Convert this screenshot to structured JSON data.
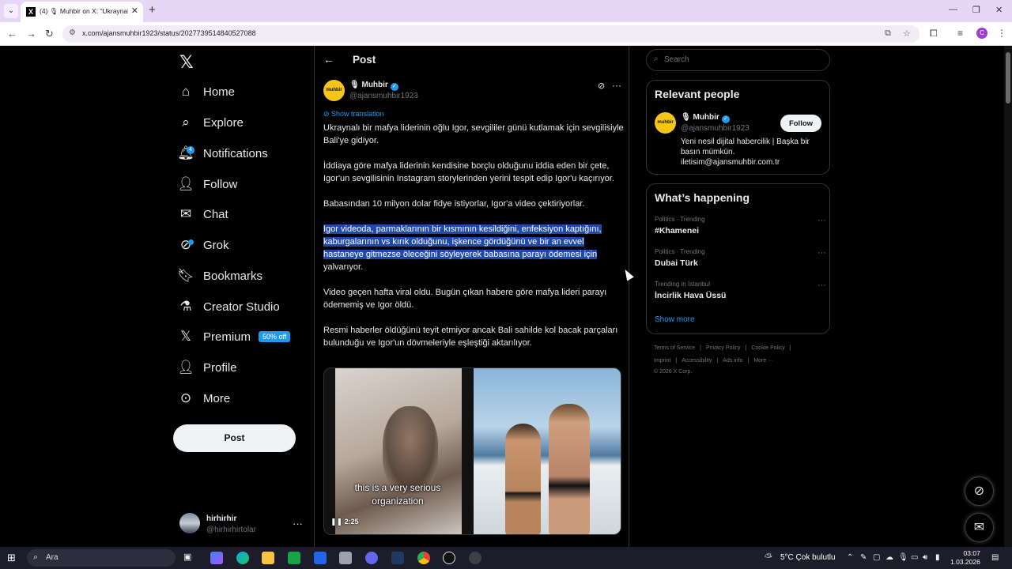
{
  "browser": {
    "tab_title": "(4) 🎙 Muhbir on X: \"Ukraynalı",
    "url": "x.com/ajansmuhbir1923/status/2027739514840527088"
  },
  "sidebar": {
    "items": [
      {
        "label": "Home",
        "icon": "home-icon"
      },
      {
        "label": "Explore",
        "icon": "search-icon"
      },
      {
        "label": "Notifications",
        "icon": "bell-icon",
        "badge": "4"
      },
      {
        "label": "Follow",
        "icon": "person-plus-icon"
      },
      {
        "label": "Chat",
        "icon": "mail-icon"
      },
      {
        "label": "Grok",
        "icon": "grok-icon"
      },
      {
        "label": "Bookmarks",
        "icon": "bookmark-icon"
      },
      {
        "label": "Creator Studio",
        "icon": "flask-icon"
      },
      {
        "label": "Premium",
        "icon": "x-icon",
        "badge": "50% off"
      },
      {
        "label": "Profile",
        "icon": "person-icon"
      },
      {
        "label": "More",
        "icon": "more-circle-icon"
      }
    ],
    "post_button": "Post",
    "account": {
      "name": "hirhirhir",
      "handle": "@hirhirhirtolar"
    }
  },
  "main": {
    "heading": "Post",
    "author": {
      "name": "Muhbir",
      "handle": "@ajansmuhbir1923",
      "avatar_text": "muhbir"
    },
    "show_translation": "Show translation",
    "paragraphs": [
      "Ukraynalı bir mafya liderinin oğlu Igor, sevgililer günü kutlamak için sevgilisiyle Bali'ye gidiyor.",
      "İddiaya göre mafya liderinin kendisine borçlu olduğunu iddia eden bir çete, Igor'un sevgilisinin Instagram storylerinden yerini tespit edip Igor'u kaçırıyor.",
      "Babasından 10 milyon dolar fidye istiyorlar, Igor'a video çektiriyorlar."
    ],
    "selected_text": "Igor videoda, parmaklarının bir kısmının kesildiğini, enfeksiyon kaptığını, kaburgalarının vs kırık olduğunu, işkence gördüğünü ve bir an evvel hastaneye gitmezse öleceğini söyleyerek babasına parayı ödemesi için",
    "selected_tail": " yalvarıyor.",
    "paragraphs_after": [
      "Video geçen hafta viral oldu. Bugün çıkan habere göre mafya lideri parayı ödememiş ve Igor öldü.",
      "Resmi haberler öldüğünü teyit etmiyor ancak Bali sahilde kol bacak parçaları bulunduğu ve Igor'un dövmeleriyle eşleştiği aktarılıyor."
    ],
    "media": {
      "caption": "this is a very serious organization",
      "time": "2:25"
    }
  },
  "right": {
    "search_placeholder": "Search",
    "relevant": {
      "title": "Relevant people",
      "name": "Muhbir",
      "handle": "@ajansmuhbir1923",
      "follow": "Follow",
      "bio": "Yeni nesil dijital habercilik | Başka bir basın mümkün. iletisim@ajansmuhbir.com.tr"
    },
    "happening": {
      "title": "What’s happening",
      "trends": [
        {
          "meta": "Politics · Trending",
          "name": "#Khamenei"
        },
        {
          "meta": "Politics · Trending",
          "name": "Dubai Türk"
        },
        {
          "meta": "Trending in İstanbul",
          "name": "İncirlik Hava Üssü"
        }
      ],
      "show_more": "Show more"
    },
    "footer": {
      "links1": [
        "Terms of Service",
        "|",
        "Privacy Policy",
        "|",
        "Cookie Policy",
        "|"
      ],
      "links2": [
        "Imprint",
        "|",
        "Accessibility",
        "|",
        "Ads info",
        "|",
        "More ···"
      ],
      "copyright": "© 2026 X Corp."
    }
  },
  "taskbar": {
    "search_label": "Ara",
    "weather": "5°C  Çok bulutlu",
    "time": "03:07",
    "date": "1.03.2026"
  },
  "colors": {
    "accent": "#1d9bf0",
    "selection": "#1f4aa8",
    "tab_bar": "#e7d6f5"
  }
}
